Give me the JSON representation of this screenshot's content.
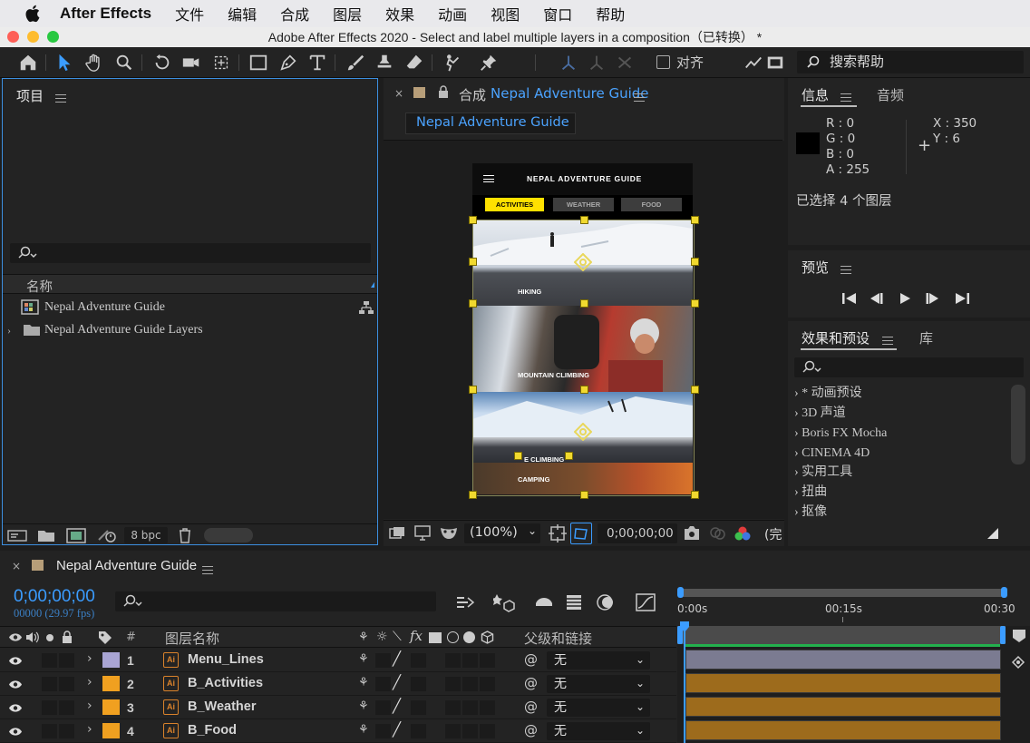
{
  "menubar": {
    "app_name": "After Effects",
    "items": [
      "文件",
      "编辑",
      "合成",
      "图层",
      "效果",
      "动画",
      "视图",
      "窗口",
      "帮助"
    ]
  },
  "window": {
    "title": "Adobe After Effects 2020 - Select and label multiple layers in a composition（已转换） *"
  },
  "toolbar": {
    "snap_label": "对齐",
    "search_help_placeholder": "搜索帮助"
  },
  "project_panel": {
    "tab_label": "项目",
    "column_name": "名称",
    "items": [
      {
        "label": "Nepal Adventure Guide",
        "icon": "composition-icon"
      },
      {
        "label": "Nepal Adventure Guide Layers",
        "icon": "folder-icon"
      }
    ],
    "bpc_label": "8 bpc"
  },
  "composition_panel": {
    "tab_prefix": "合成",
    "tab_name": "Nepal Adventure Guide",
    "breadcrumb": "Nepal Adventure Guide",
    "zoom_label": "(100%)",
    "timecode": "0;00;00;00",
    "quality_label": "(完"
  },
  "mockup": {
    "title": "NEPAL ADVENTURE GUIDE",
    "tabs": [
      "ACTIVITIES",
      "WEATHER",
      "FOOD"
    ],
    "cards": [
      "HIKING",
      "MOUNTAIN CLIMBING",
      "E CLIMBING",
      "CAMPING"
    ],
    "colors": {
      "accent": "#ffe100",
      "bar": "#111111"
    }
  },
  "info_panel": {
    "tab_info": "信息",
    "tab_audio": "音频",
    "r": "R : 0",
    "g": "G : 0",
    "b": "B : 0",
    "a": "A : 255",
    "x": "X : 350",
    "y": "Y : 6",
    "selection_text": "已选择 4 个图层"
  },
  "preview_panel": {
    "tab_label": "预览"
  },
  "effects_panel": {
    "tab_label": "效果和预设",
    "tab_library": "库",
    "items": [
      "* 动画预设",
      "3D 声道",
      "Boris FX Mocha",
      "CINEMA 4D",
      "实用工具",
      "扭曲",
      "抠像"
    ]
  },
  "timeline": {
    "tab_name": "Nepal Adventure Guide",
    "timecode": "0;00;00;00",
    "frame_info": "00000 (29.97 fps)",
    "col_hash": "#",
    "col_layer_name": "图层名称",
    "col_parent": "父级和链接",
    "ruler": [
      "0:00s",
      "00:15s",
      "00:30"
    ],
    "layers": [
      {
        "num": "1",
        "name": "Menu_Lines",
        "parent": "无",
        "label_color": "#a9a5d4"
      },
      {
        "num": "2",
        "name": "B_Activities",
        "parent": "无",
        "label_color": "#f0a020"
      },
      {
        "num": "3",
        "name": "B_Weather",
        "parent": "无",
        "label_color": "#f0a020"
      },
      {
        "num": "4",
        "name": "B_Food",
        "parent": "无",
        "label_color": "#f0a020"
      }
    ]
  }
}
